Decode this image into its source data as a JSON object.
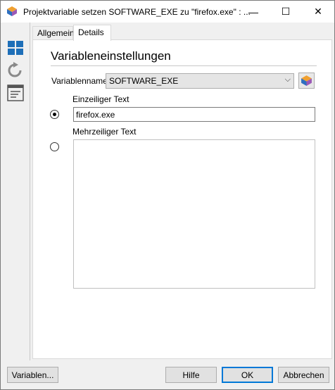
{
  "window": {
    "title": "Projektvariable setzen SOFTWARE_EXE zu \"firefox.exe\" : ...",
    "minimize_glyph": "—",
    "maximize_glyph": "☐",
    "close_glyph": "✕"
  },
  "sidebar": {
    "icons": [
      "grid-icon",
      "undo-icon",
      "list-form-icon"
    ]
  },
  "tabs": [
    {
      "label": "Allgemein",
      "active": false
    },
    {
      "label": "Details",
      "active": true
    }
  ],
  "section": {
    "title": "Variableneinstellungen",
    "variable_name_label": "Variablenname",
    "variable_name_value": "SOFTWARE_EXE",
    "single_line_label": "Einzeiliger Text",
    "single_line_value": "firefox.exe",
    "single_line_selected": true,
    "multi_line_label": "Mehrzeiliger Text",
    "multi_line_value": "",
    "multi_line_selected": false
  },
  "buttons": {
    "variables": "Variablen...",
    "help": "Hilfe",
    "ok": "OK",
    "cancel": "Abbrechen"
  },
  "colors": {
    "accent": "#0078d7",
    "icon_blue": "#1e6fb8",
    "icon_grey": "#7a7a7a"
  }
}
